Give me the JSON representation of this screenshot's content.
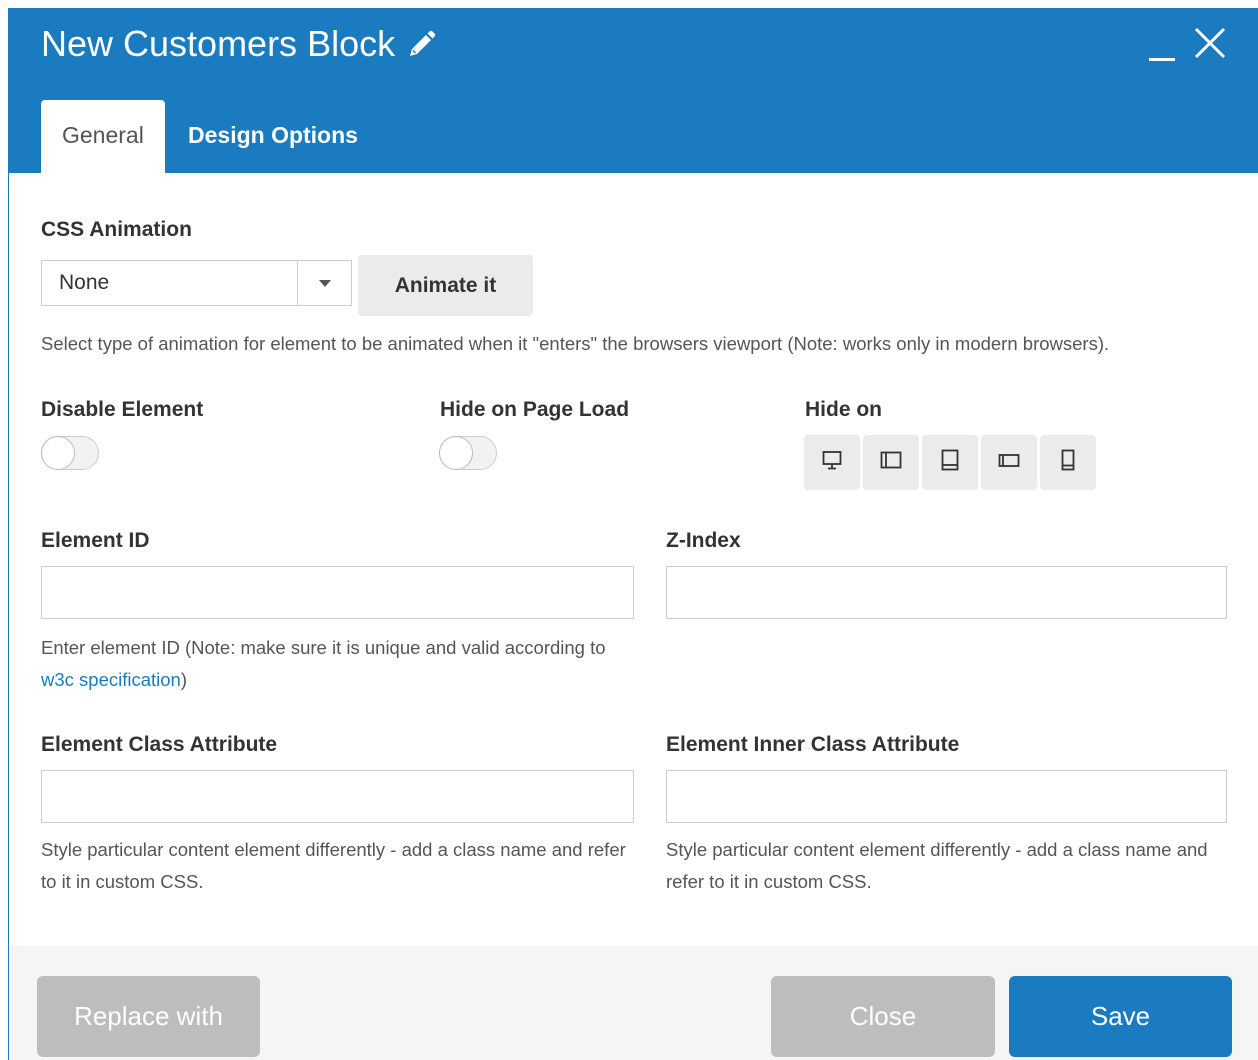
{
  "header": {
    "title": "New Customers Block",
    "edit_icon": "pencil-icon",
    "minimize_label": "_",
    "close_icon": "close-icon"
  },
  "tabs": [
    {
      "label": "General",
      "active": true
    },
    {
      "label": "Design Options",
      "active": false
    }
  ],
  "css_animation": {
    "label": "CSS Animation",
    "selected": "None",
    "button": "Animate it",
    "help": "Select type of animation for element to be animated when it \"enters\" the browsers viewport (Note: works only in modern browsers)."
  },
  "disable_element": {
    "label": "Disable Element",
    "on": false
  },
  "hide_on_page_load": {
    "label": "Hide on Page Load",
    "on": false
  },
  "hide_on": {
    "label": "Hide on",
    "devices": [
      "desktop-icon",
      "tablet-landscape-icon",
      "tablet-portrait-icon",
      "phone-landscape-icon",
      "phone-portrait-icon"
    ]
  },
  "element_id": {
    "label": "Element ID",
    "value": "",
    "help_before": "Enter element ID (Note: make sure it is unique and valid according to ",
    "help_link": "w3c specification",
    "help_after": ")"
  },
  "z_index": {
    "label": "Z-Index",
    "value": ""
  },
  "element_class": {
    "label": "Element Class Attribute",
    "value": "",
    "help": "Style particular content element differently - add a class name and refer to it in custom CSS."
  },
  "element_inner_class": {
    "label": "Element Inner Class Attribute",
    "value": "",
    "help": "Style particular content element differently - add a class name and refer to it in custom CSS."
  },
  "footer": {
    "replace_label": "Replace with",
    "close_label": "Close",
    "save_label": "Save"
  },
  "colors": {
    "primary": "#1a7bc0",
    "muted_button": "#bdbdbd",
    "light_button": "#ebebeb"
  }
}
